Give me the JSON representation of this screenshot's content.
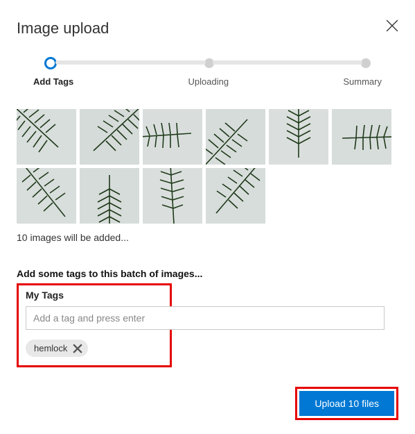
{
  "dialog": {
    "title": "Image upload"
  },
  "stepper": {
    "step1": "Add Tags",
    "step2": "Uploading",
    "step3": "Summary"
  },
  "images": {
    "count_text": "10 images will be added..."
  },
  "tags": {
    "prompt": "Add some tags to this batch of images...",
    "section_label": "My Tags",
    "placeholder": "Add a tag and press enter",
    "chips": [
      {
        "label": "hemlock"
      }
    ]
  },
  "footer": {
    "upload_label": "Upload 10 files"
  }
}
